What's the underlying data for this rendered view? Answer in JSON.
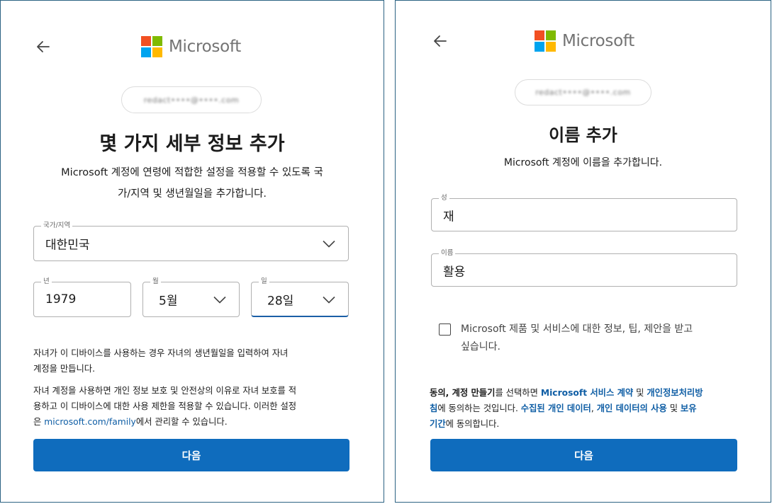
{
  "brand": {
    "name": "Microsoft",
    "colors": {
      "red": "#f25022",
      "green": "#7fba00",
      "blue": "#00a4ef",
      "yellow": "#ffb900",
      "button": "#0f6cbd",
      "link": "#0f5ea5"
    }
  },
  "left": {
    "email": "redact••••@••••.com",
    "title": "몇 가지 세부 정보 추가",
    "desc_line1": "Microsoft 계정에 연령에 적합한 설정을 적용할 수 있도록 국",
    "desc_line2": "가/지역 및 생년월일을 추가합니다.",
    "country": {
      "label": "국가/지역",
      "value": "대한민국"
    },
    "year": {
      "label": "년",
      "value": "1979"
    },
    "month": {
      "label": "월",
      "value": "5월"
    },
    "day": {
      "label": "일",
      "value": "28일"
    },
    "note1_line1": "자녀가 이 디바이스를 사용하는 경우 자녀의 생년월일을 입력하여 자녀",
    "note1_line2": "계정을 만듭니다.",
    "note2_line1": "자녀 계정을 사용하면 개인 정보 보호 및 안전상의 이유로 자녀 보호를 적",
    "note2_line2": "용하고 이 디바이스에 대한 사용 제한을 적용할 수 있습니다. 이러한 설정",
    "note2_pre": "은 ",
    "note2_link": "microsoft.com/family",
    "note2_post": "에서 관리할 수 있습니다.",
    "next": "다음"
  },
  "right": {
    "email": "redact••••@••••.com",
    "title": "이름 추가",
    "desc": "Microsoft 계정에 이름을 추가합니다.",
    "last_name": {
      "label": "성",
      "value": "재"
    },
    "first_name": {
      "label": "이름",
      "value": "활용"
    },
    "checkbox_line1": "Microsoft 제품 및 서비스에 대한 정보, 팁, 제안을 받고",
    "checkbox_line2": "싶습니다.",
    "consent": {
      "b1": "동의, 계정 만들기",
      "t1": "를 선택하면 ",
      "l1": "Microsoft 서비스 계약",
      "t2": " 및 ",
      "l2a": "개인정보처리방",
      "l2b": "침",
      "t3": "에 동의하는 것입니다. ",
      "l3": "수집된 개인 데이터",
      "t4": ", ",
      "l4": "개인 데이터의 사용",
      "t5": " 및 ",
      "l5a": "보유",
      "l5b": "기간",
      "t6": "에 동의합니다."
    },
    "next": "다음"
  }
}
